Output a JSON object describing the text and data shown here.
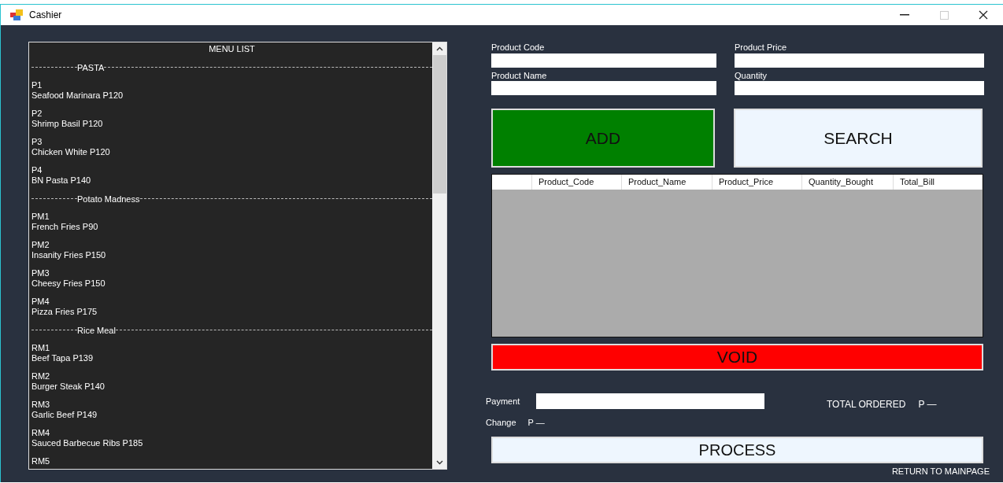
{
  "window": {
    "title": "Cashier"
  },
  "menu_list": {
    "title": "MENU LIST",
    "sections": [
      {
        "title": "PASTA",
        "items": [
          {
            "code": "P1",
            "name": "Seafood Marinara P120"
          },
          {
            "code": "P2",
            "name": "Shrimp Basil P120"
          },
          {
            "code": "P3",
            "name": "Chicken White P120"
          },
          {
            "code": "P4",
            "name": "BN Pasta P140"
          }
        ]
      },
      {
        "title": "Potato Madness",
        "items": [
          {
            "code": "PM1",
            "name": "French Fries P90"
          },
          {
            "code": "PM2",
            "name": "Insanity Fries P150"
          },
          {
            "code": "PM3",
            "name": "Cheesy Fries P150"
          },
          {
            "code": "PM4",
            "name": "Pizza Fries P175"
          }
        ]
      },
      {
        "title": "Rice Meal",
        "items": [
          {
            "code": "RM1",
            "name": "Beef Tapa P139"
          },
          {
            "code": "RM2",
            "name": "Burger Steak P140"
          },
          {
            "code": "RM3",
            "name": "Garlic Beef P149"
          },
          {
            "code": "RM4",
            "name": "Sauced Barbecue Ribs P185"
          },
          {
            "code": "RM5"
          }
        ]
      }
    ]
  },
  "fields": [
    {
      "label": "Product Code"
    },
    {
      "label": "Product Price"
    },
    {
      "label": "Product Name"
    },
    {
      "label": "Quantity"
    }
  ],
  "buttons": [
    {
      "label": "ADD",
      "kind": "add"
    },
    {
      "label": "SEARCH",
      "kind": "search"
    }
  ],
  "table": {
    "columns": [
      "Product_Code",
      "Product_Name",
      "Product_Price",
      "Quantity_Bought",
      "Total_Bill"
    ]
  },
  "void_button": "VOID",
  "payment": {
    "label": "Payment"
  },
  "change": {
    "label": "Change",
    "value": "P —"
  },
  "total": {
    "label": "TOTAL ORDERED",
    "value": "P —"
  },
  "process_button": "PROCESS",
  "return_link": "RETURN TO MAINPAGE"
}
